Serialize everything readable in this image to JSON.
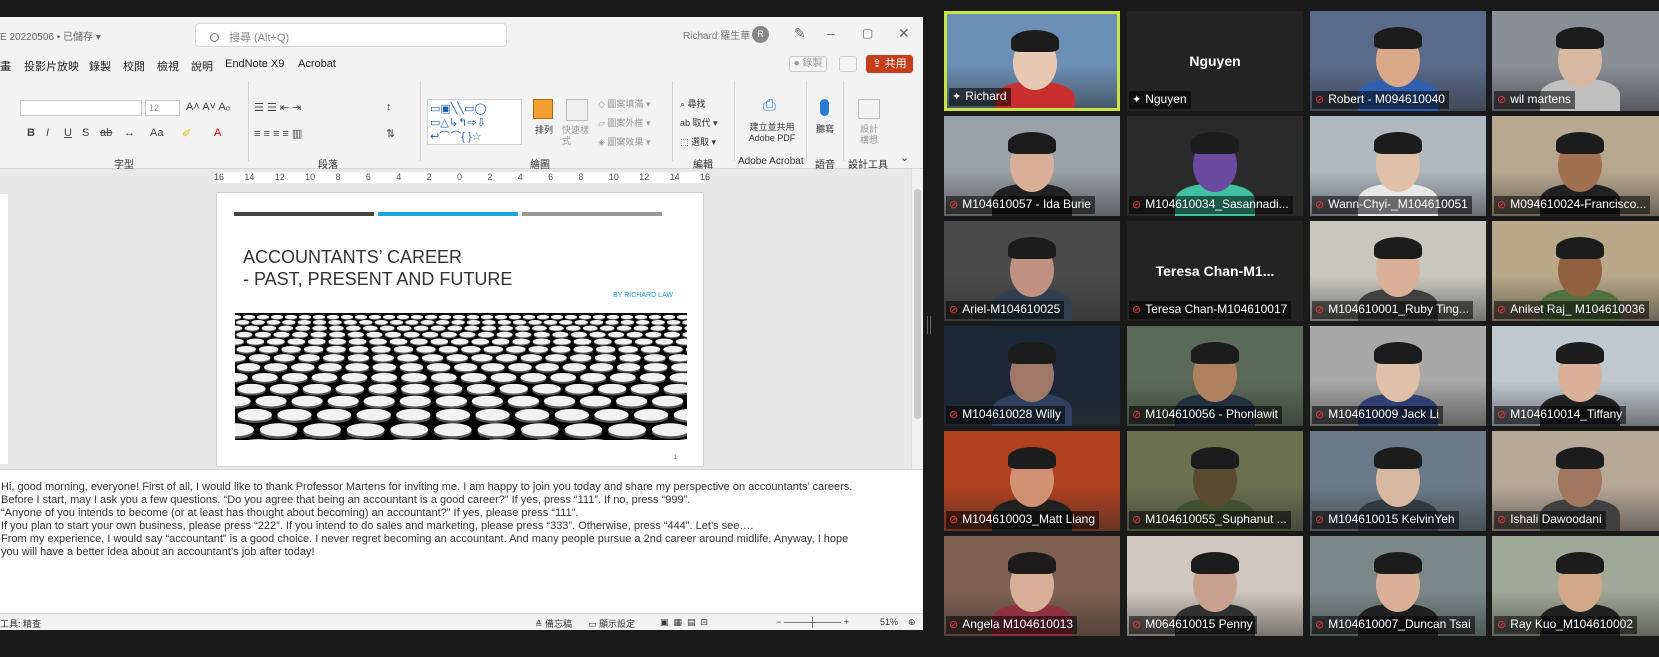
{
  "word": {
    "doc_title": "E 20220506 • 已儲存 ▾",
    "search_placeholder": "搜尋 (Alt+Q)",
    "user_name": "Richard 羅生華",
    "user_initial": "R",
    "menu": [
      "畫",
      "投影片放映",
      "錄製",
      "校閱",
      "檢視",
      "說明",
      "EndNote X9",
      "Acrobat"
    ],
    "record_label": "錄製",
    "share_label": "共用",
    "font_size": "12",
    "groups": [
      "字型",
      "段落",
      "繪圖",
      "編輯",
      "Adobe Acrobat",
      "語音",
      "設計工具"
    ],
    "arrange_label": "排列",
    "quick_styles_label": "快速樣式",
    "shape_fill": "圖案填滿",
    "shape_outline": "圖案外框",
    "shape_effects": "圖案效果",
    "find_label": "尋找",
    "replace_label": "取代",
    "select_label": "選取",
    "create_pdf_label": "建立並共用 Adobe PDF",
    "dictate_label": "聽寫",
    "designer_label": "設計 構想",
    "ruler_ticks": [
      "16",
      "14",
      "12",
      "10",
      "8",
      "6",
      "4",
      "2",
      "0",
      "2",
      "4",
      "6",
      "8",
      "10",
      "12",
      "14",
      "16"
    ],
    "slide": {
      "title": "ACCOUNTANTS’ CAREER\n- PAST, PRESENT AND FUTURE",
      "subtitle": "BY RICHARD LAW",
      "number": "1"
    },
    "notes": [
      "Hi, good morning, everyone! First of all, I would like to thank Professor Martens for inviting me. I am happy to join you today and share my perspective on accountants’ careers.",
      "Before I start, may I ask you a few questions. “Do you agree that being an accountant is a good career?” If yes, press “111”. If no, press “999”.",
      "“Anyone of you intends to become (or at least has thought about becoming) an accountant?”  If yes, please press “111”.",
      "If you plan to start your own business, please press “222”.  If you intend to do sales and marketing, please press “333”. Otherwise, press “444”. Let’s see….",
      "From my experience, I would say “accountant” is a good choice. I never regret becoming an accountant. And many people pursue a 2nd career around midlife. Anyway, I hope",
      "you will have a better idea about an accountant’s job after today!"
    ],
    "status": {
      "left": "工具: 精查",
      "notes_btn": "備忘稿",
      "display_settings": "顯示設定",
      "zoom": "51%"
    }
  },
  "zoom_gallery": {
    "colors": {
      "active_speaker": "#c7e348",
      "muted_icon": "#e5343c",
      "tile_bg": "#232323"
    },
    "participants": [
      {
        "name": "Richard",
        "muted": false,
        "active": true
      },
      {
        "name": "Nguyen",
        "muted": false,
        "video": false,
        "display": "Nguyen"
      },
      {
        "name": "Robert - M094610040",
        "muted": true
      },
      {
        "name": "wil martens",
        "muted": true
      },
      {
        "name": "M104610057 - Ida Burie",
        "muted": true
      },
      {
        "name": "M104610034_Sasannadi...",
        "muted": true
      },
      {
        "name": "Wann-Chyi-_M104610051",
        "muted": true
      },
      {
        "name": "M094610024-Francisco...",
        "muted": true
      },
      {
        "name": "Ariel-M104610025",
        "muted": true
      },
      {
        "name": "Teresa Chan-M104610017",
        "muted": true,
        "video": false,
        "display": "Teresa  Chan-M1..."
      },
      {
        "name": "M104610001_Ruby Ting...",
        "muted": true
      },
      {
        "name": "Aniket Raj_ M104610036",
        "muted": true
      },
      {
        "name": "M104610028 Willy",
        "muted": true
      },
      {
        "name": "M104610056 - Phonlawit",
        "muted": true
      },
      {
        "name": "M104610009 Jack Li",
        "muted": true
      },
      {
        "name": "M104610014_Tiffany",
        "muted": true
      },
      {
        "name": "M104610003_Matt Liang",
        "muted": true
      },
      {
        "name": "M104610055_Suphanut ...",
        "muted": true
      },
      {
        "name": "M104610015 KelvinYeh",
        "muted": true
      },
      {
        "name": "Ishali Dawoodani",
        "muted": true
      },
      {
        "name": "Angela M104610013",
        "muted": true
      },
      {
        "name": "M064610015 Penny",
        "muted": true
      },
      {
        "name": "M104610007_Duncan Tsai",
        "muted": true
      },
      {
        "name": "Ray Kuo_M104610002",
        "muted": true
      }
    ]
  }
}
